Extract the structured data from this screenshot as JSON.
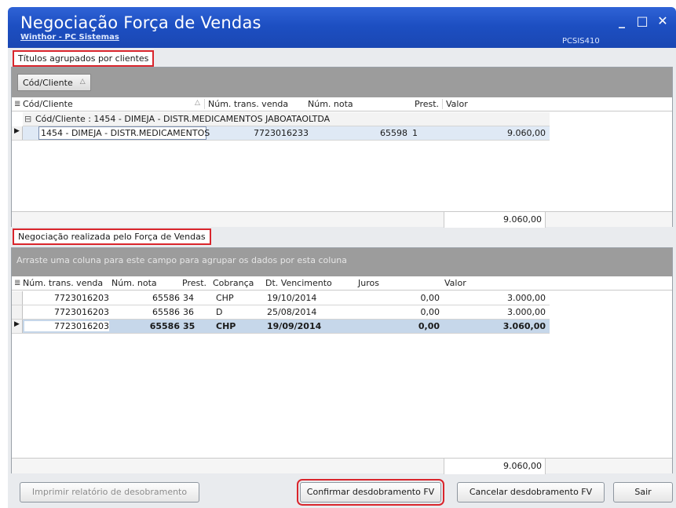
{
  "window": {
    "title": "Negociação Força de Vendas",
    "subtitle": "Winthor - PC Sistemas",
    "code": "PCSIS410",
    "controls": {
      "minimize": "_",
      "maximize": "□",
      "close": "✕"
    }
  },
  "top_panel": {
    "label": "Títulos agrupados por clientes",
    "group_chip": "Cód/Cliente",
    "columns": [
      "Cód/Cliente",
      "Núm. trans. venda",
      "Núm. nota",
      "Prest.",
      "Valor"
    ],
    "group_row": "Cód/Cliente : 1454 - DIMEJA - DISTR.MEDICAMENTOS JABOATAOLTDA",
    "rows": [
      {
        "cliente": "1454 - DIMEJA - DISTR.MEDICAMENTOS",
        "trans": "7723016233",
        "nota": "65598",
        "prest": "1",
        "valor": "9.060,00"
      }
    ],
    "total": "9.060,00"
  },
  "bottom_panel": {
    "label": "Negociação realizada pelo Força de Vendas",
    "group_hint": "Arraste uma coluna para este campo para agrupar os dados por esta coluna",
    "columns": [
      "Núm. trans. venda",
      "Núm. nota",
      "Prest.",
      "Cobrança",
      "Dt. Vencimento",
      "Juros",
      "Valor"
    ],
    "rows": [
      {
        "trans": "7723016203",
        "nota": "65586",
        "prest": "34",
        "cobranca": "CHP",
        "venc": "19/10/2014",
        "juros": "0,00",
        "valor": "3.000,00"
      },
      {
        "trans": "7723016203",
        "nota": "65586",
        "prest": "36",
        "cobranca": "D",
        "venc": "25/08/2014",
        "juros": "0,00",
        "valor": "3.000,00"
      },
      {
        "trans": "7723016203",
        "nota": "65586",
        "prest": "35",
        "cobranca": "CHP",
        "venc": "19/09/2014",
        "juros": "0,00",
        "valor": "3.060,00"
      }
    ],
    "total": "9.060,00"
  },
  "buttons": {
    "print": "Imprimir relatório de desobramento",
    "confirm": "Confirmar desdobramento FV",
    "cancel": "Cancelar desdobramento FV",
    "exit": "Sair"
  },
  "colors": {
    "titlebar": "#1d4fc2",
    "highlight": "#d9252c",
    "selected_row": "#c6d7ea"
  }
}
